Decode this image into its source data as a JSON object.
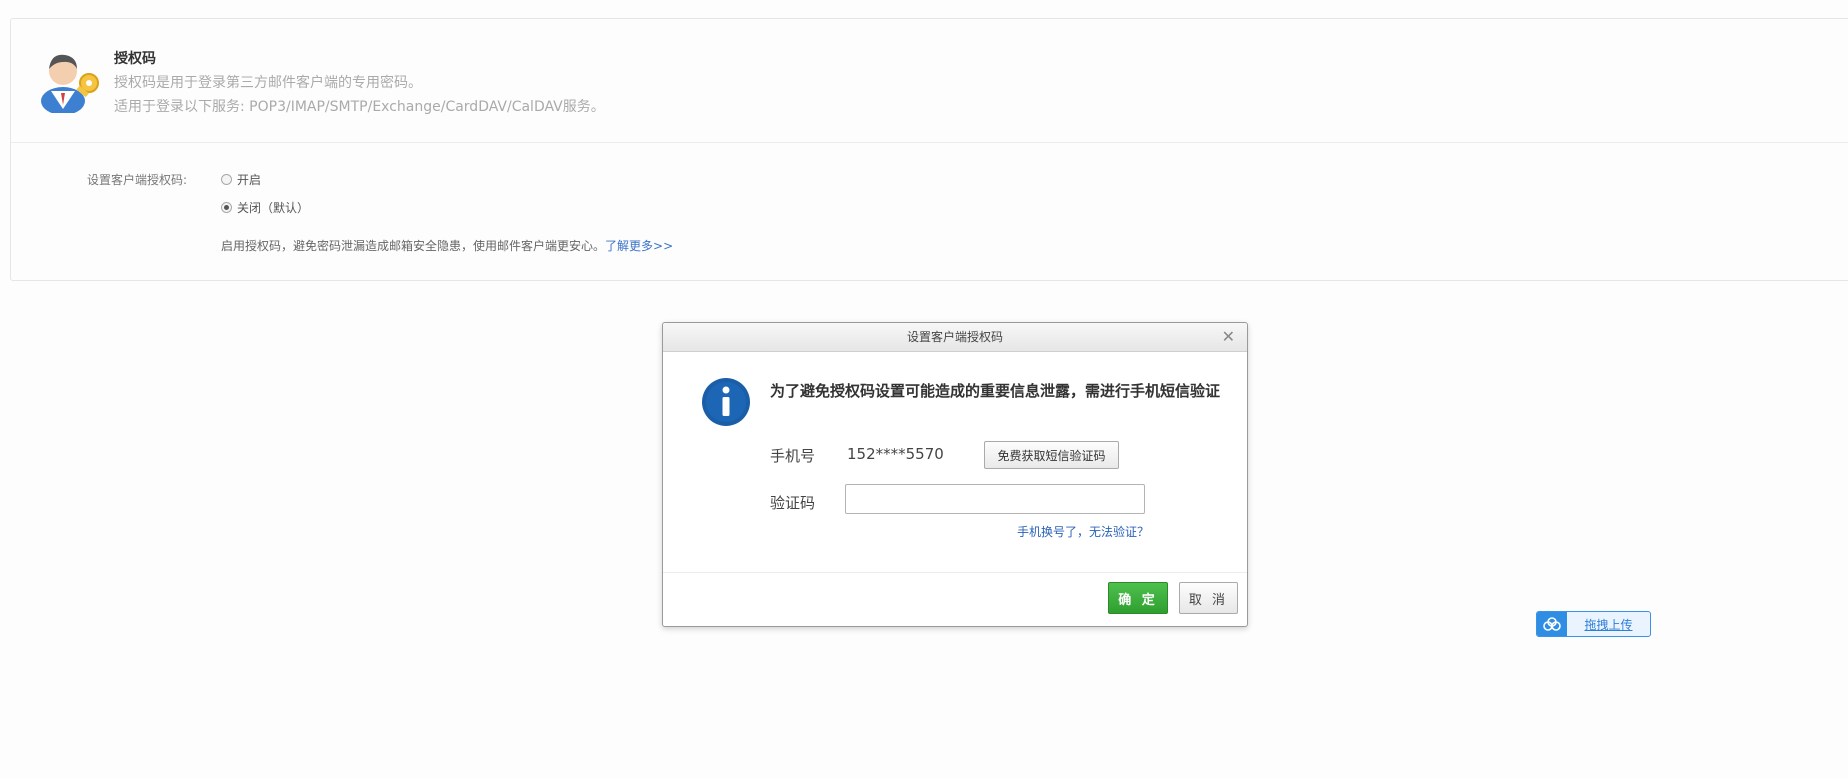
{
  "auth_panel": {
    "title": "授权码",
    "desc_line1": "授权码是用于登录第三方邮件客户端的专用密码。",
    "desc_line2": "适用于登录以下服务: POP3/IMAP/SMTP/Exchange/CardDAV/CalDAV服务。",
    "setting_label": "设置客户端授权码:",
    "options": [
      {
        "label": "开启",
        "checked": false
      },
      {
        "label": "关闭（默认）",
        "checked": true
      }
    ],
    "hint_text": "启用授权码，避免密码泄漏造成邮箱安全隐患，使用邮件客户端更安心。",
    "hint_link": "了解更多>>"
  },
  "dialog": {
    "title": "设置客户端授权码",
    "close_icon": "close-icon",
    "message": "为了避免授权码设置可能造成的重要信息泄露，需进行手机短信验证",
    "phone_label": "手机号",
    "phone_value": "152****5570",
    "sms_button": "免费获取短信验证码",
    "code_label": "验证码",
    "code_value": "",
    "changed_phone_link": "手机换号了，无法验证？",
    "ok_button": "确 定",
    "cancel_button": "取 消"
  },
  "upload": {
    "label": "拖拽上传",
    "icon": "cloud-upload-icon"
  },
  "colors": {
    "link": "#3a73c8",
    "ok_green": "#3aae3a",
    "info_blue": "#1a5ea8",
    "upload_blue": "#2f8de4"
  }
}
